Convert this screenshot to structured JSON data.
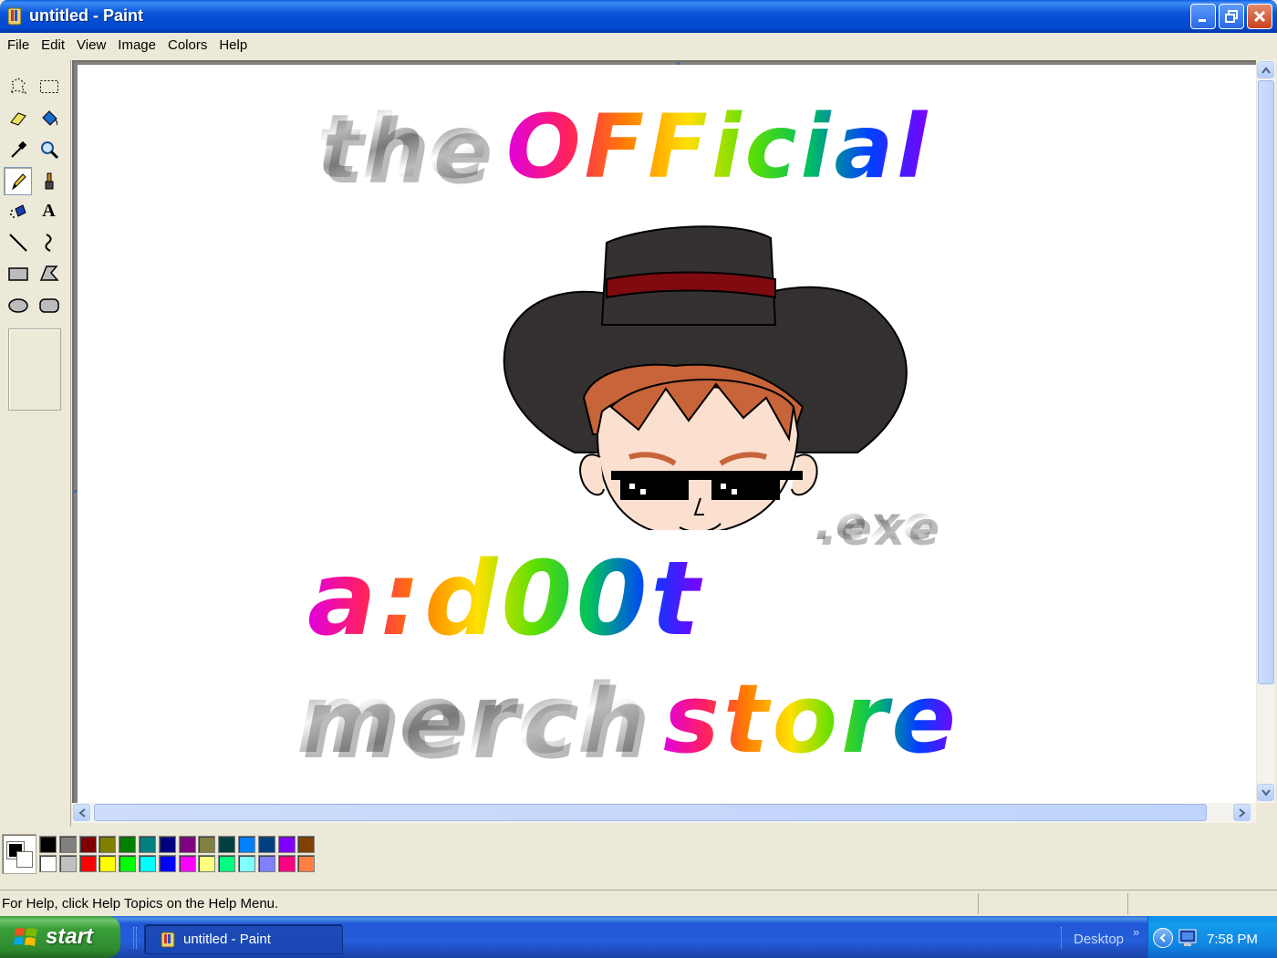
{
  "window": {
    "title": "untitled - Paint",
    "icon": "paint-app-icon"
  },
  "menu": [
    "File",
    "Edit",
    "View",
    "Image",
    "Colors",
    "Help"
  ],
  "toolbox": {
    "tools": [
      {
        "name": "free-form-select",
        "icon": "free-form-select-icon"
      },
      {
        "name": "select",
        "icon": "rect-select-icon"
      },
      {
        "name": "eraser",
        "icon": "eraser-icon"
      },
      {
        "name": "fill",
        "icon": "fill-bucket-icon"
      },
      {
        "name": "pick-color",
        "icon": "eyedropper-icon"
      },
      {
        "name": "magnifier",
        "icon": "magnifier-icon"
      },
      {
        "name": "pencil",
        "icon": "pencil-icon",
        "selected": true
      },
      {
        "name": "brush",
        "icon": "brush-icon"
      },
      {
        "name": "airbrush",
        "icon": "airbrush-icon"
      },
      {
        "name": "text",
        "icon": "text-icon",
        "glyph": "A"
      },
      {
        "name": "line",
        "icon": "line-icon"
      },
      {
        "name": "curve",
        "icon": "curve-icon"
      },
      {
        "name": "rectangle",
        "icon": "rectangle-icon"
      },
      {
        "name": "polygon",
        "icon": "polygon-icon"
      },
      {
        "name": "ellipse",
        "icon": "ellipse-icon"
      },
      {
        "name": "rounded-rectangle",
        "icon": "rounded-rectangle-icon"
      }
    ]
  },
  "artwork": {
    "line1_a": "the",
    "line1_b": "OFFicial",
    "badge": ".exe",
    "line2": "a:d00t",
    "line3_a": "merch",
    "line3_b": "store"
  },
  "palette": {
    "foreground": "#000000",
    "background": "#FFFFFF",
    "top_row": [
      "#000000",
      "#808080",
      "#800000",
      "#808000",
      "#008000",
      "#008080",
      "#000080",
      "#800080",
      "#808040",
      "#004040",
      "#0080FF",
      "#004080",
      "#8000FF",
      "#804000"
    ],
    "bottom_row": [
      "#FFFFFF",
      "#C0C0C0",
      "#FF0000",
      "#FFFF00",
      "#00FF00",
      "#00FFFF",
      "#0000FF",
      "#FF00FF",
      "#FFFF80",
      "#00FF80",
      "#80FFFF",
      "#8080FF",
      "#FF0080",
      "#FF8040"
    ]
  },
  "status": {
    "help_text": "For Help, click Help Topics on the Help Menu."
  },
  "taskbar": {
    "start_label": "start",
    "task_label": "untitled - Paint",
    "desktop_label": "Desktop",
    "clock": "7:58 PM"
  }
}
